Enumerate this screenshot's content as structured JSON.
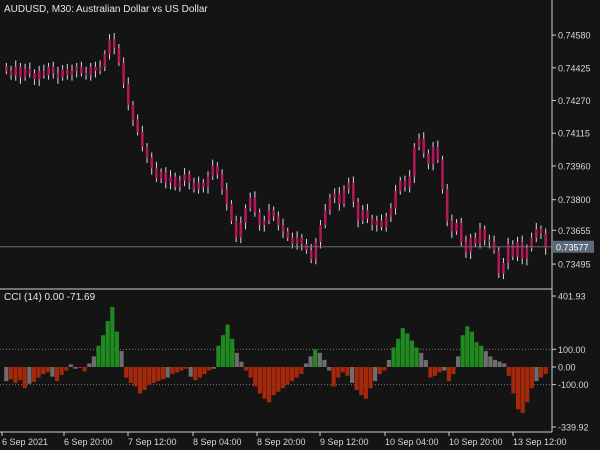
{
  "window": {
    "symbol_label": "AUDUSD, M30:",
    "description": "Australian Dollar vs US Dollar"
  },
  "indicator": {
    "label": "CCI (14) 0.00 -71.69"
  },
  "colors": {
    "background": "#141414",
    "candle": "#b0185a",
    "candle_shadow": "#d8d8d8",
    "grid_separator": "#cfcfcf",
    "price_line": "#6a6a6a",
    "current_price_tag_bg": "#5a6a7a",
    "cci_up": "#1f8a1f",
    "cci_down": "#a5280a",
    "cci_neutral": "#6e6e6e",
    "level_line": "#7a7a7a"
  },
  "price_axis": {
    "ticks": [
      "0.74580",
      "0.74425",
      "0.74270",
      "0.74115",
      "0.73960",
      "0.73800",
      "0.73655",
      "0.73495"
    ],
    "current_price": "0.73577"
  },
  "cci_axis": {
    "ticks": [
      "401.93",
      "100.00",
      "0.00",
      "-100.00",
      "-339.92"
    ]
  },
  "time_axis": {
    "labels": [
      "6 Sep 2021",
      "6 Sep 20:00",
      "7 Sep 12:00",
      "8 Sep 04:00",
      "8 Sep 20:00",
      "9 Sep 12:00",
      "10 Sep 04:00",
      "10 Sep 20:00",
      "13 Sep 12:00"
    ]
  },
  "chart_data": [
    {
      "type": "candlestick",
      "title": "AUDUSD, M30:  Australian Dollar vs US Dollar",
      "ylim": [
        0.7341,
        0.7468
      ],
      "y_ticks": [
        0.7458,
        0.74425,
        0.7427,
        0.74115,
        0.7396,
        0.738,
        0.73655,
        0.73495
      ],
      "current_price": 0.73577,
      "x_labels": [
        "6 Sep 2021",
        "6 Sep 20:00",
        "7 Sep 12:00",
        "8 Sep 04:00",
        "8 Sep 20:00",
        "9 Sep 12:00",
        "10 Sep 04:00",
        "10 Sep 20:00",
        "13 Sep 12:00"
      ],
      "close": [
        0.7441,
        0.7439,
        0.7443,
        0.7438,
        0.7442,
        0.744,
        0.7437,
        0.7441,
        0.7439,
        0.7443,
        0.744,
        0.7438,
        0.7442,
        0.7439,
        0.7441,
        0.7443,
        0.744,
        0.7439,
        0.7443,
        0.7441,
        0.7443,
        0.7449,
        0.7456,
        0.7452,
        0.7445,
        0.7435,
        0.7425,
        0.7418,
        0.7412,
        0.7405,
        0.74,
        0.7395,
        0.739,
        0.7393,
        0.7388,
        0.7391,
        0.7386,
        0.7389,
        0.7392,
        0.7388,
        0.7385,
        0.7388,
        0.7386,
        0.7391,
        0.7396,
        0.7392,
        0.7385,
        0.7378,
        0.737,
        0.7362,
        0.7369,
        0.7376,
        0.7381,
        0.7374,
        0.7368,
        0.737,
        0.7375,
        0.7372,
        0.7368,
        0.7365,
        0.7362,
        0.7359,
        0.7362,
        0.7359,
        0.7356,
        0.7352,
        0.736,
        0.7368,
        0.7375,
        0.7381,
        0.7383,
        0.7378,
        0.7385,
        0.7388,
        0.7379,
        0.737,
        0.7375,
        0.7371,
        0.7368,
        0.737,
        0.7367,
        0.7372,
        0.7376,
        0.7384,
        0.7389,
        0.7386,
        0.7391,
        0.7405,
        0.7409,
        0.7402,
        0.7397,
        0.7405,
        0.7399,
        0.7385,
        0.737,
        0.7365,
        0.7369,
        0.736,
        0.7355,
        0.7362,
        0.7359,
        0.7366,
        0.7361,
        0.736,
        0.7356,
        0.7345,
        0.735,
        0.7359,
        0.7353,
        0.736,
        0.7352,
        0.7357,
        0.7362,
        0.7366,
        0.7364,
        0.7357
      ]
    },
    {
      "type": "bar",
      "title": "CCI (14) 0.00 -71.69",
      "ylim": [
        -339.92,
        401.93
      ],
      "levels": [
        100,
        0,
        -100
      ],
      "values": [
        -80,
        -70,
        -90,
        -75,
        -120,
        -95,
        -85,
        -60,
        -40,
        -30,
        -55,
        -80,
        -45,
        -20,
        15,
        -10,
        -5,
        -25,
        20,
        60,
        120,
        180,
        260,
        340,
        200,
        90,
        -60,
        -90,
        -110,
        -150,
        -130,
        -100,
        -90,
        -80,
        -70,
        -60,
        -40,
        -30,
        -20,
        -10,
        -55,
        -75,
        -60,
        -40,
        -20,
        -10,
        120,
        180,
        240,
        160,
        80,
        30,
        -20,
        -60,
        -110,
        -150,
        -180,
        -200,
        -160,
        -140,
        -120,
        -100,
        -80,
        -60,
        -40,
        20,
        60,
        100,
        80,
        40,
        -20,
        -110,
        -60,
        -30,
        -50,
        -90,
        -130,
        -160,
        -180,
        -120,
        -80,
        -40,
        -20,
        40,
        110,
        160,
        220,
        190,
        150,
        110,
        80,
        40,
        -60,
        -50,
        -30,
        -20,
        -80,
        -40,
        60,
        180,
        230,
        200,
        140,
        120,
        90,
        60,
        40,
        30,
        20,
        -50,
        -150,
        -240,
        -260,
        -200,
        -120,
        -80,
        -60,
        -40
      ]
    }
  ]
}
